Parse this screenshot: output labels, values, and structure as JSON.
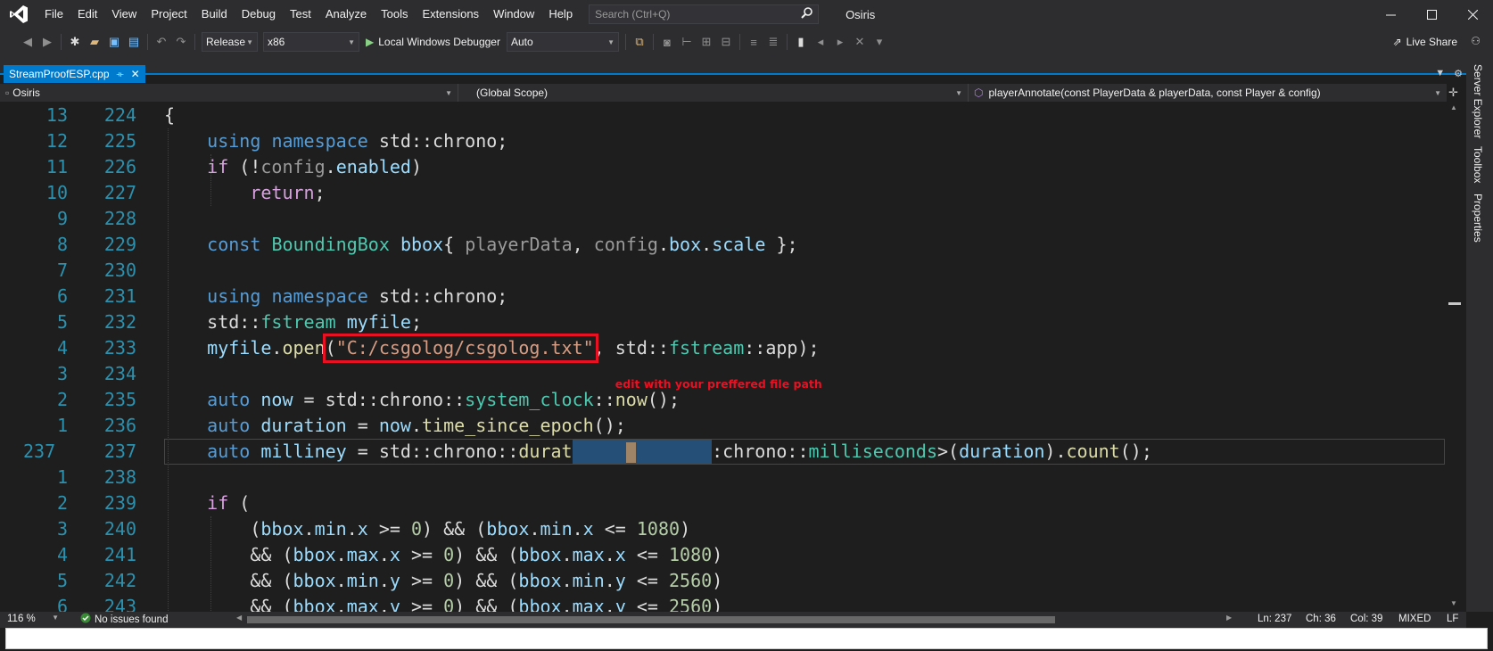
{
  "colors": {
    "accent": "#007acc",
    "highlight": "#e81123",
    "line_number": "#2b91af",
    "selection": "#264f78"
  },
  "menu": {
    "items": [
      "File",
      "Edit",
      "View",
      "Project",
      "Build",
      "Debug",
      "Test",
      "Analyze",
      "Tools",
      "Extensions",
      "Window",
      "Help"
    ],
    "search_placeholder": "Search (Ctrl+Q)",
    "app_title": "Osiris"
  },
  "toolbar": {
    "configuration": "Release",
    "platform": "x86",
    "run_label": "Local Windows Debugger",
    "run_mode": "Auto",
    "live_share": "Live Share"
  },
  "tab": {
    "filename": "StreamProofESP.cpp"
  },
  "navbar": {
    "project": "Osiris",
    "scope": "(Global Scope)",
    "member": "playerAnnotate(const PlayerData & playerData, const Player & config)"
  },
  "side_panel": {
    "items": [
      "Server Explorer",
      "Toolbox",
      "Properties"
    ]
  },
  "editor": {
    "relative_line_numbers": [
      "13",
      "12",
      "11",
      "10",
      "9",
      "8",
      "7",
      "6",
      "5",
      "4",
      "3",
      "2",
      "1",
      "237",
      "1",
      "2",
      "3",
      "4",
      "5",
      "6"
    ],
    "line_numbers": [
      "224",
      "225",
      "226",
      "227",
      "228",
      "229",
      "230",
      "231",
      "232",
      "233",
      "234",
      "235",
      "236",
      "237",
      "238",
      "239",
      "240",
      "241",
      "242",
      "243"
    ],
    "annotation": "edit with your preffered file path"
  },
  "status": {
    "zoom": "116 %",
    "issues": "No issues found",
    "ln": "Ln: 237",
    "ch": "Ch: 36",
    "col": "Col: 39",
    "whitespace": "MIXED",
    "eol": "LF"
  }
}
